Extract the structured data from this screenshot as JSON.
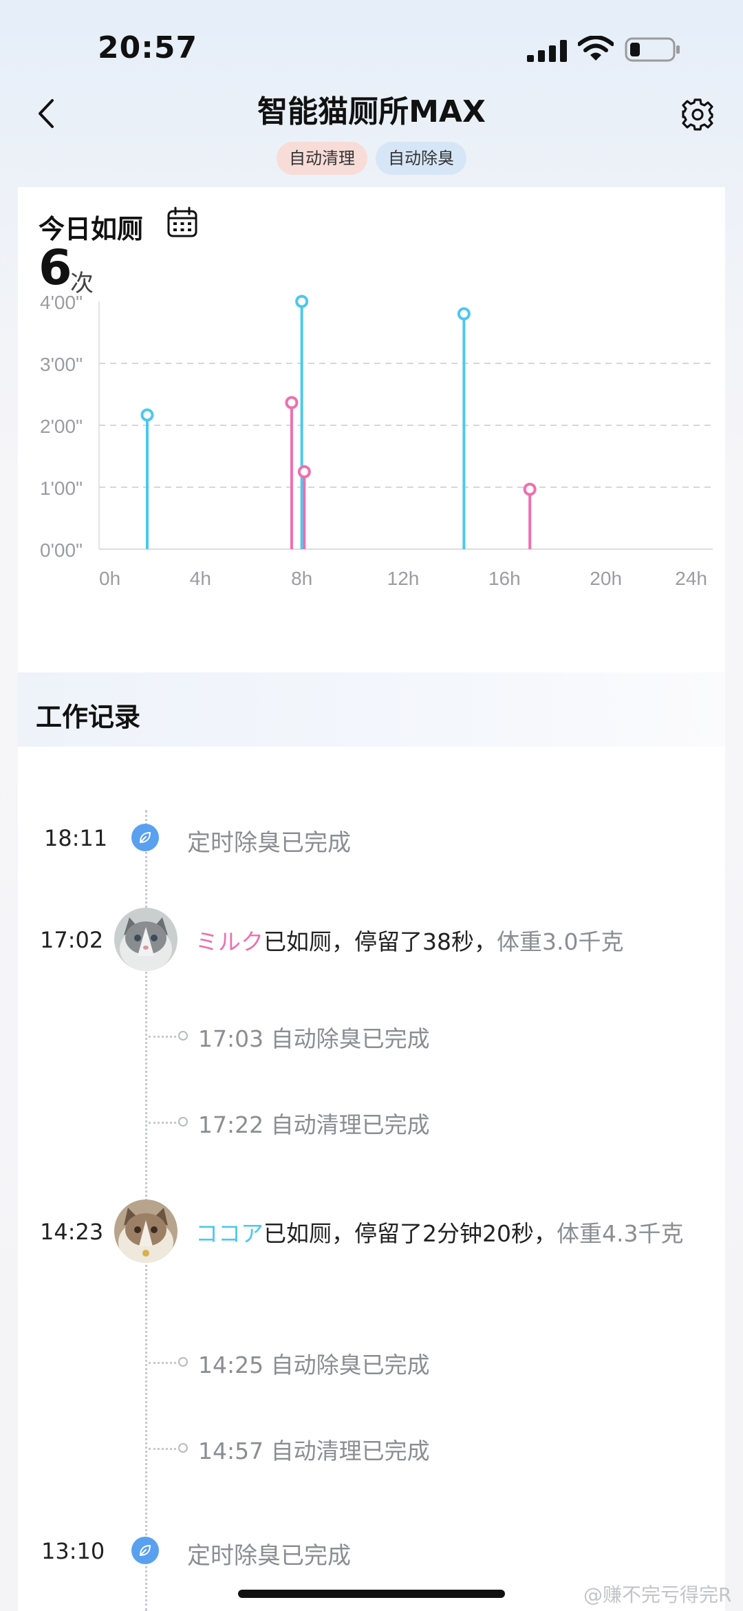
{
  "status": {
    "time": "20:57"
  },
  "header": {
    "title": "智能猫厕所MAX",
    "tags": [
      "自动清理",
      "自动除臭"
    ]
  },
  "today": {
    "title": "今日如厕",
    "count": "6",
    "count_unit": "次"
  },
  "chart_data": {
    "type": "scatter",
    "title": "",
    "xlabel": "",
    "ylabel": "",
    "x_ticks": [
      "0h",
      "4h",
      "8h",
      "12h",
      "16h",
      "20h",
      "24h"
    ],
    "y_ticks": [
      "0'00\"",
      "1'00\"",
      "2'00\"",
      "3'00\"",
      "4'00\""
    ],
    "xlim": [
      0,
      24
    ],
    "ylim": [
      0,
      240
    ],
    "y_unit": "seconds",
    "grid": true,
    "series": [
      {
        "color": "#4cc8ee",
        "points": [
          [
            1.9,
            130
          ],
          [
            8.0,
            240
          ],
          [
            14.4,
            228
          ]
        ]
      },
      {
        "color": "#ef6fae",
        "points": [
          [
            7.6,
            142
          ],
          [
            8.1,
            75
          ],
          [
            17.0,
            58
          ]
        ]
      }
    ]
  },
  "records": {
    "title": "工作记录",
    "items": [
      {
        "time": "18:11",
        "text": "定时除臭已完成"
      },
      {
        "time": "17:02",
        "cat": "ミルク",
        "msg": "已如厕，停留了38秒，",
        "weight": "体重3.0千克"
      },
      {
        "sub": "17:03 自动除臭已完成"
      },
      {
        "sub": "17:22 自动清理已完成"
      },
      {
        "time": "14:23",
        "cat": "ココア",
        "msg": "已如厕，停留了2分钟20秒，",
        "weight": "体重4.3千克"
      },
      {
        "sub": "14:25 自动除臭已完成"
      },
      {
        "sub": "14:57 自动清理已完成"
      },
      {
        "time": "13:10",
        "text": "定时除臭已完成"
      }
    ]
  },
  "watermark": "@赚不完亏得完R"
}
